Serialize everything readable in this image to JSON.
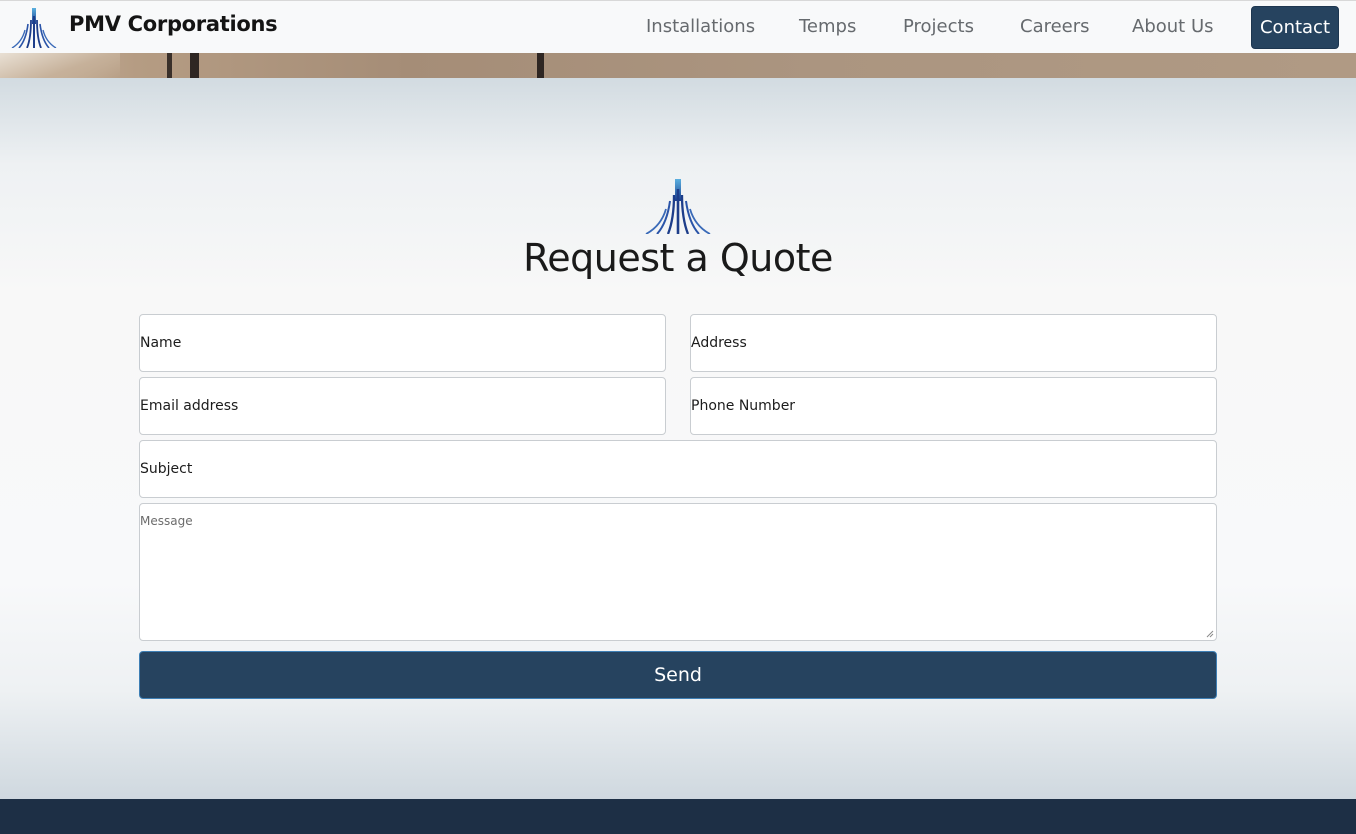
{
  "header": {
    "brand_name": "PMV Corporations",
    "logo_icon": "pmv-logo-icon",
    "nav": [
      "Installations",
      "Temps",
      "Projects",
      "Careers",
      "About Us"
    ],
    "contact_label": "Contact"
  },
  "section": {
    "logo_icon": "pmv-logo-icon",
    "title": "Request a Quote"
  },
  "form": {
    "name_placeholder": "Name",
    "address_placeholder": "Address",
    "email_placeholder": "Email address",
    "phone_placeholder": "Phone Number",
    "subject_placeholder": "Subject",
    "message_placeholder": "Message",
    "send_label": "Send"
  },
  "colors": {
    "primary": "#26435f",
    "footer": "#1d2f45",
    "nav_text": "#666a6e"
  }
}
